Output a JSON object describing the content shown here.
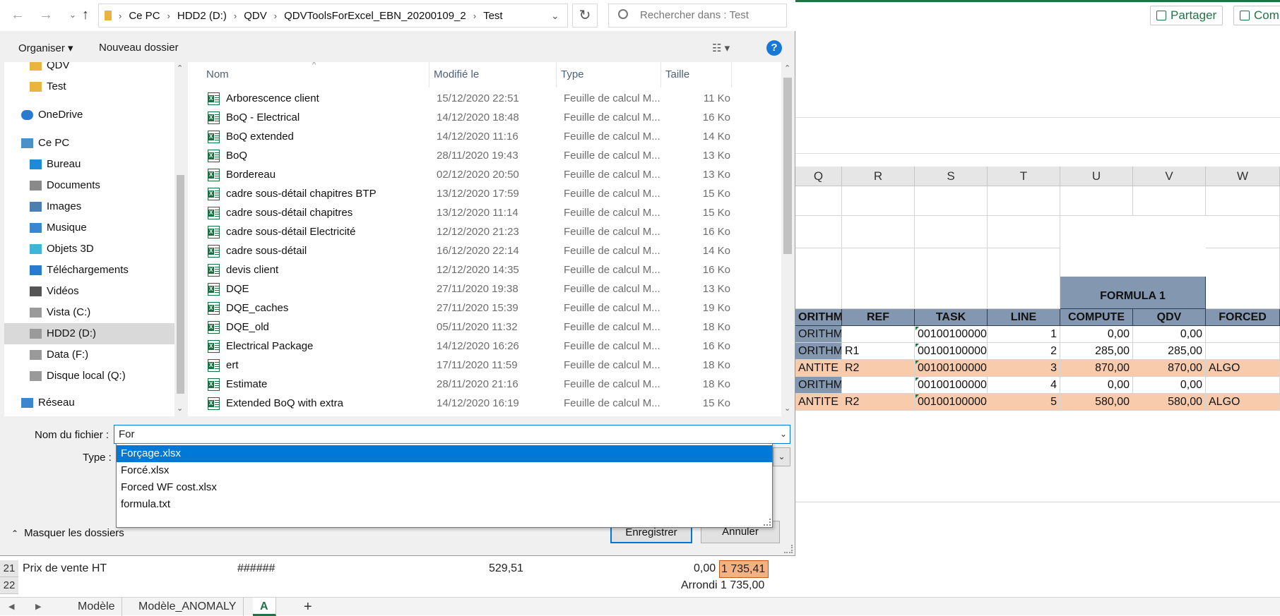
{
  "excel": {
    "share_label": "Partager",
    "comments_label": "Com",
    "columns": [
      "Q",
      "R",
      "S",
      "T",
      "U",
      "V",
      "W"
    ],
    "group_header": "FORMULA 1",
    "headers": [
      "ORITHM",
      "REF",
      "TASK",
      "LINE",
      "COMPUTE",
      "QDV",
      "FORCED"
    ],
    "rows": [
      {
        "q": "ORITHME",
        "r": "",
        "s": "00100100000",
        "t": "1",
        "u": "0,00",
        "v": "0,00",
        "w": "",
        "highlight": false
      },
      {
        "q": "ORITHME",
        "r": "R1",
        "s": "00100100000",
        "t": "2",
        "u": "285,00",
        "v": "285,00",
        "w": "",
        "highlight": false
      },
      {
        "q": "ANTITE",
        "r": "R2",
        "s": "00100100000",
        "t": "3",
        "u": "870,00",
        "v": "870,00",
        "w": "ALGO",
        "highlight": true
      },
      {
        "q": "ORITHME",
        "r": "",
        "s": "00100100000",
        "t": "4",
        "u": "0,00",
        "v": "0,00",
        "w": "",
        "highlight": false
      },
      {
        "q": "ANTITE",
        "r": "R2",
        "s": "00100100000",
        "t": "5",
        "u": "580,00",
        "v": "580,00",
        "w": "ALGO",
        "highlight": true
      }
    ],
    "lower_rows": {
      "row21_num": "21",
      "row21_label": "Prix de vente HT",
      "row21_hash": "######",
      "row21_value": "529,51",
      "row21_zero": "0,00",
      "row21_total": "1 735,41",
      "row22_num": "22",
      "row22_label": "Arrondi",
      "row22_total": "1 735,00"
    },
    "sheet_tabs": [
      "Modèle",
      "Modèle_ANOMALY",
      "A"
    ],
    "active_tab": "A",
    "add_sheet": "+"
  },
  "dialog": {
    "breadcrumb": [
      "Ce PC",
      "HDD2 (D:)",
      "QDV",
      "QDVToolsForExcel_EBN_20200109_2",
      "Test"
    ],
    "search_placeholder": "Rechercher dans : Test",
    "toolbar": {
      "organize": "Organiser ▾",
      "new_folder": "Nouveau dossier",
      "view": "☷ ▾",
      "help": "?"
    },
    "nav_items": [
      {
        "label": "QDV",
        "icon": "folder"
      },
      {
        "label": "Test",
        "icon": "folder"
      },
      {
        "label": "OneDrive",
        "icon": "cloud"
      },
      {
        "label": "Ce PC",
        "icon": "pc"
      },
      {
        "label": "Bureau",
        "icon": "desktop"
      },
      {
        "label": "Documents",
        "icon": "documents"
      },
      {
        "label": "Images",
        "icon": "images"
      },
      {
        "label": "Musique",
        "icon": "music"
      },
      {
        "label": "Objets 3D",
        "icon": "cube"
      },
      {
        "label": "Téléchargements",
        "icon": "download"
      },
      {
        "label": "Vidéos",
        "icon": "video"
      },
      {
        "label": "Vista (C:)",
        "icon": "drive"
      },
      {
        "label": "HDD2 (D:)",
        "icon": "drive",
        "selected": true
      },
      {
        "label": "Data (F:)",
        "icon": "drive"
      },
      {
        "label": "Disque local (Q:)",
        "icon": "drive"
      },
      {
        "label": "Réseau",
        "icon": "network"
      }
    ],
    "columns": {
      "name": "Nom",
      "modified": "Modifié le",
      "type": "Type",
      "size": "Taille"
    },
    "files": [
      {
        "name": "Arborescence client",
        "modified": "15/12/2020 22:51",
        "type": "Feuille de calcul M...",
        "size": "11 Ko"
      },
      {
        "name": "BoQ - Electrical",
        "modified": "14/12/2020 18:48",
        "type": "Feuille de calcul M...",
        "size": "16 Ko"
      },
      {
        "name": "BoQ extended",
        "modified": "14/12/2020 11:16",
        "type": "Feuille de calcul M...",
        "size": "14 Ko"
      },
      {
        "name": "BoQ",
        "modified": "28/11/2020 19:43",
        "type": "Feuille de calcul M...",
        "size": "13 Ko"
      },
      {
        "name": "Bordereau",
        "modified": "02/12/2020 20:50",
        "type": "Feuille de calcul M...",
        "size": "13 Ko"
      },
      {
        "name": "cadre sous-détail chapitres BTP",
        "modified": "13/12/2020 17:59",
        "type": "Feuille de calcul M...",
        "size": "15 Ko"
      },
      {
        "name": "cadre sous-détail chapitres",
        "modified": "13/12/2020 11:14",
        "type": "Feuille de calcul M...",
        "size": "15 Ko"
      },
      {
        "name": "cadre sous-détail Electricité",
        "modified": "12/12/2020 21:23",
        "type": "Feuille de calcul M...",
        "size": "16 Ko"
      },
      {
        "name": "cadre sous-détail",
        "modified": "16/12/2020 22:14",
        "type": "Feuille de calcul M...",
        "size": "14 Ko"
      },
      {
        "name": "devis client",
        "modified": "12/12/2020 14:35",
        "type": "Feuille de calcul M...",
        "size": "16 Ko"
      },
      {
        "name": "DQE",
        "modified": "27/11/2020 19:38",
        "type": "Feuille de calcul M...",
        "size": "13 Ko"
      },
      {
        "name": "DQE_caches",
        "modified": "27/11/2020 15:39",
        "type": "Feuille de calcul M...",
        "size": "19 Ko"
      },
      {
        "name": "DQE_old",
        "modified": "05/11/2020 11:32",
        "type": "Feuille de calcul M...",
        "size": "18 Ko"
      },
      {
        "name": "Electrical Package",
        "modified": "14/12/2020 16:26",
        "type": "Feuille de calcul M...",
        "size": "16 Ko"
      },
      {
        "name": "ert",
        "modified": "17/11/2020 11:59",
        "type": "Feuille de calcul M...",
        "size": "18 Ko"
      },
      {
        "name": "Estimate",
        "modified": "28/11/2020 21:16",
        "type": "Feuille de calcul M...",
        "size": "18 Ko"
      },
      {
        "name": "Extended BoQ with extra",
        "modified": "14/12/2020 16:19",
        "type": "Feuille de calcul M...",
        "size": "15 Ko"
      }
    ],
    "filename_label": "Nom du fichier :",
    "filename_value": "For",
    "type_label": "Type :",
    "suggestions": [
      "Forçage.xlsx",
      "Forcé.xlsx",
      "Forced WF cost.xlsx",
      "formula.txt"
    ],
    "save_button": "Enregistrer",
    "cancel_button": "Annuler",
    "hide_folders": "Masquer les dossiers"
  }
}
